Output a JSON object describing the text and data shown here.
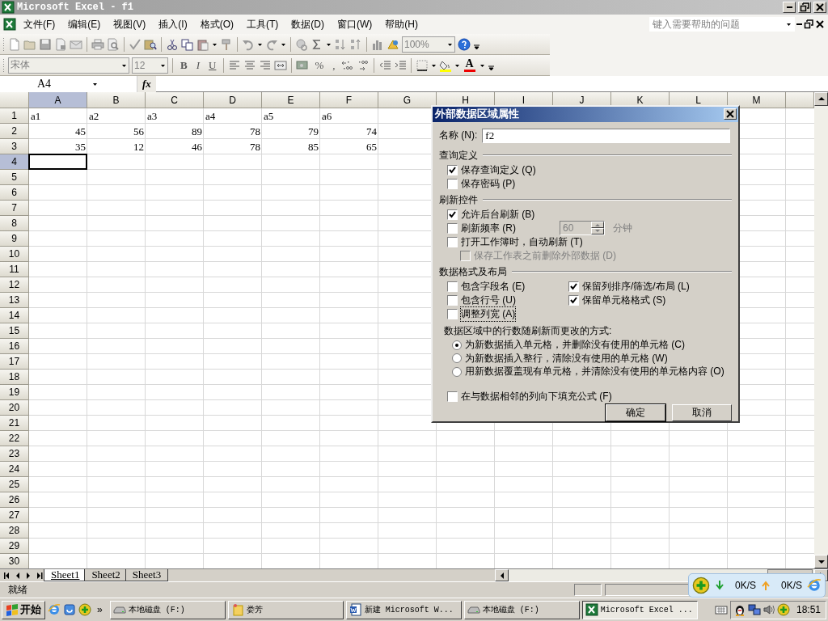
{
  "window": {
    "title": "Microsoft Excel - f1"
  },
  "menu": {
    "items": [
      "文件(F)",
      "编辑(E)",
      "视图(V)",
      "插入(I)",
      "格式(O)",
      "工具(T)",
      "数据(D)",
      "窗口(W)",
      "帮助(H)"
    ],
    "help_placeholder": "键入需要帮助的问题"
  },
  "standard_toolbar": {
    "zoom": "100%"
  },
  "format_toolbar": {
    "font": "宋体",
    "size": "12",
    "style_buttons": [
      {
        "kind": "bold",
        "label": "B"
      },
      {
        "kind": "italic",
        "label": "I"
      },
      {
        "kind": "underline",
        "label": "U"
      }
    ],
    "percent": "%",
    "comma": ",",
    "font_color": "A"
  },
  "formula_bar": {
    "name_box": "A4",
    "function_label": "fx"
  },
  "sheet": {
    "columns": [
      {
        "label": "A",
        "selected": true
      },
      {
        "label": "B",
        "selected": false
      },
      {
        "label": "C",
        "selected": false
      },
      {
        "label": "D",
        "selected": false
      },
      {
        "label": "E",
        "selected": false
      },
      {
        "label": "F",
        "selected": false
      },
      {
        "label": "G",
        "selected": false
      },
      {
        "label": "H",
        "selected": false
      },
      {
        "label": "I",
        "selected": false
      },
      {
        "label": "J",
        "selected": false
      },
      {
        "label": "K",
        "selected": false
      },
      {
        "label": "L",
        "selected": false
      },
      {
        "label": "M",
        "selected": false
      }
    ],
    "rows": [
      {
        "label": "1",
        "selected": false,
        "cells": [
          {
            "text": "a1",
            "kind": "text"
          },
          {
            "text": "a2",
            "kind": "text"
          },
          {
            "text": "a3",
            "kind": "text"
          },
          {
            "text": "a4",
            "kind": "text"
          },
          {
            "text": "a5",
            "kind": "text"
          },
          {
            "text": "a6",
            "kind": "text"
          }
        ]
      },
      {
        "label": "2",
        "selected": false,
        "cells": [
          {
            "text": "45",
            "kind": "number"
          },
          {
            "text": "56",
            "kind": "number"
          },
          {
            "text": "89",
            "kind": "number"
          },
          {
            "text": "78",
            "kind": "number"
          },
          {
            "text": "79",
            "kind": "number"
          },
          {
            "text": "74",
            "kind": "number"
          }
        ]
      },
      {
        "label": "3",
        "selected": false,
        "cells": [
          {
            "text": "35",
            "kind": "number"
          },
          {
            "text": "12",
            "kind": "number"
          },
          {
            "text": "46",
            "kind": "number"
          },
          {
            "text": "78",
            "kind": "number"
          },
          {
            "text": "85",
            "kind": "number"
          },
          {
            "text": "65",
            "kind": "number"
          }
        ]
      },
      {
        "label": "4",
        "selected": true
      },
      {
        "label": "5",
        "selected": false
      },
      {
        "label": "6",
        "selected": false
      },
      {
        "label": "7",
        "selected": false
      },
      {
        "label": "8",
        "selected": false
      },
      {
        "label": "9",
        "selected": false
      },
      {
        "label": "10",
        "selected": false
      },
      {
        "label": "11",
        "selected": false
      },
      {
        "label": "12",
        "selected": false
      },
      {
        "label": "13",
        "selected": false
      },
      {
        "label": "14",
        "selected": false
      },
      {
        "label": "15",
        "selected": false
      },
      {
        "label": "16",
        "selected": false
      },
      {
        "label": "17",
        "selected": false
      },
      {
        "label": "18",
        "selected": false
      },
      {
        "label": "19",
        "selected": false
      },
      {
        "label": "20",
        "selected": false
      },
      {
        "label": "21",
        "selected": false
      },
      {
        "label": "22",
        "selected": false
      },
      {
        "label": "23",
        "selected": false
      },
      {
        "label": "24",
        "selected": false
      },
      {
        "label": "25",
        "selected": false
      },
      {
        "label": "26",
        "selected": false
      },
      {
        "label": "27",
        "selected": false
      },
      {
        "label": "28",
        "selected": false
      },
      {
        "label": "29",
        "selected": false
      },
      {
        "label": "30",
        "selected": false
      }
    ]
  },
  "sheet_tabs": [
    {
      "label": "Sheet1",
      "selected": true
    },
    {
      "label": "Sheet2",
      "selected": false
    },
    {
      "label": "Sheet3",
      "selected": false
    }
  ],
  "status_bar": {
    "text": "就绪"
  },
  "net_widget": {
    "download": "0K/S",
    "upload": "0K/S"
  },
  "dialog": {
    "title": "外部数据区域属性",
    "name_label": "名称 (N):",
    "name_value": "f2",
    "query_group": {
      "title": "查询定义",
      "items": [
        {
          "label": "保存查询定义 (Q)",
          "checked": true
        },
        {
          "label": "保存密码 (P)",
          "checked": false
        }
      ]
    },
    "refresh_group": {
      "title": "刷新控件",
      "items": [
        {
          "label": "允许后台刷新 (B)",
          "checked": true,
          "disabled": false
        },
        {
          "label": "刷新频率 (R)",
          "checked": false,
          "disabled": false,
          "spinner": {
            "value": "60",
            "disabled": true
          },
          "unit": "分钟"
        },
        {
          "label": "打开工作簿时，自动刷新 (T)",
          "checked": false,
          "disabled": false,
          "children": [
            {
              "label": "保存工作表之前删除外部数据 (D)",
              "checked": false,
              "disabled": true
            }
          ]
        }
      ]
    },
    "layout_group": {
      "title": "数据格式及布局",
      "columns": [
        [
          {
            "label": "包含字段名 (E)",
            "checked": false,
            "focused": false
          },
          {
            "label": "包含行号 (U)",
            "checked": false,
            "focused": false
          },
          {
            "label": "调整列宽 (A)",
            "checked": false,
            "focused": true
          }
        ],
        [
          {
            "label": "保留列排序/筛选/布局 (L)",
            "checked": true,
            "focused": false
          },
          {
            "label": "保留单元格格式 (S)",
            "checked": true,
            "focused": false
          }
        ]
      ]
    },
    "rows_change_label": "数据区域中的行数随刷新而更改的方式:",
    "rows_change_options": [
      {
        "label": "为新数据插入单元格，并删除没有使用的单元格 (C)",
        "selected": true
      },
      {
        "label": "为新数据插入整行，清除没有使用的单元格 (W)",
        "selected": false
      },
      {
        "label": "用新数据覆盖现有单元格，并清除没有使用的单元格内容 (O)",
        "selected": false
      }
    ],
    "fill_formulas": {
      "label": "在与数据相邻的列向下填充公式 (F)",
      "checked": false
    },
    "buttons": [
      {
        "label": "确定",
        "default": true
      },
      {
        "label": "取消",
        "default": false
      }
    ]
  },
  "taskbar": {
    "start": "开始",
    "more": "»",
    "tasks": [
      {
        "label": "本地磁盘  (F:)",
        "kind": "drive",
        "selected": false
      },
      {
        "label": "娄芳",
        "kind": "note",
        "selected": false
      },
      {
        "label": "新建 Microsoft W...",
        "kind": "word",
        "selected": false
      },
      {
        "label": "本地磁盘  (F:)",
        "kind": "drive",
        "selected": false
      },
      {
        "label": "Microsoft Excel ...",
        "kind": "excel",
        "selected": true
      }
    ],
    "clock": "18:51"
  }
}
